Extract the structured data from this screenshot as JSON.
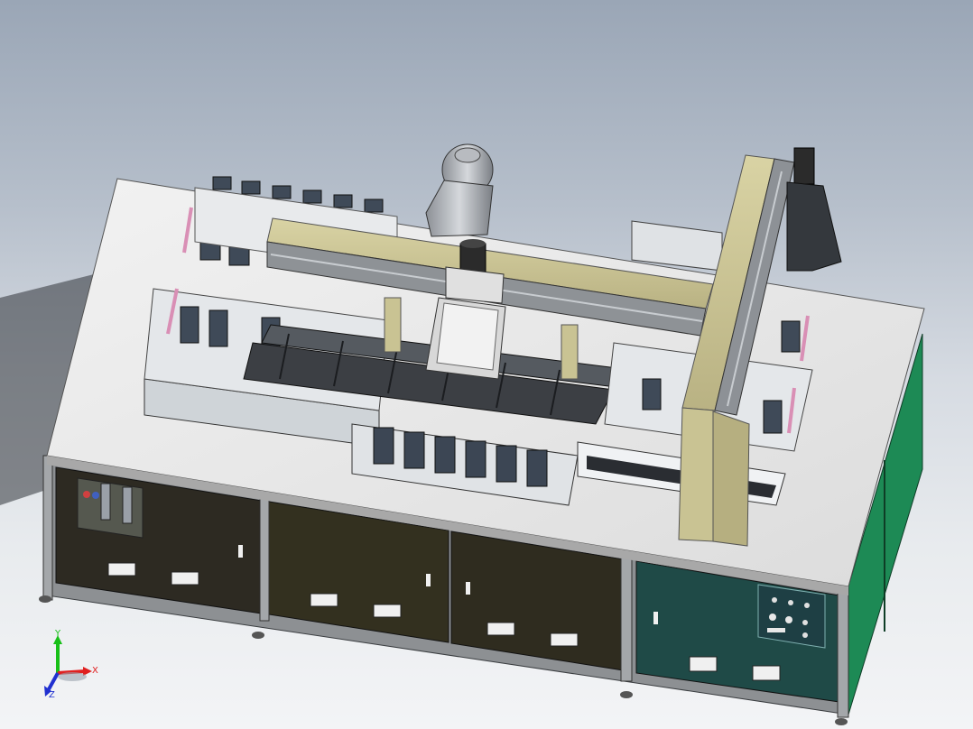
{
  "viewport": {
    "background_top": "#9aa6b6",
    "background_bottom": "#f3f4f6",
    "model": {
      "frame_color": "#8c8f91",
      "tabletop_color": "#e9e9e9",
      "panel_color_dark": "#2e2b22",
      "panel_color_teal": "#1f4a47",
      "side_panel_color": "#1d8a55",
      "gantry_color": "#c9c393",
      "conveyor_color": "#3c3f44",
      "fixture_color": "#dfe3e6"
    },
    "control_panel_icon": "control-panel-icon",
    "pneumatic_unit_icon": "pneumatic-filter-icon",
    "robot_icon": "robot-arm-icon",
    "servo_motor_icon": "servo-motor-icon"
  },
  "triad": {
    "x_label": "X",
    "y_label": "Y",
    "z_label": "Z",
    "x_color": "#e02020",
    "y_color": "#18c018",
    "z_color": "#2030d0"
  }
}
